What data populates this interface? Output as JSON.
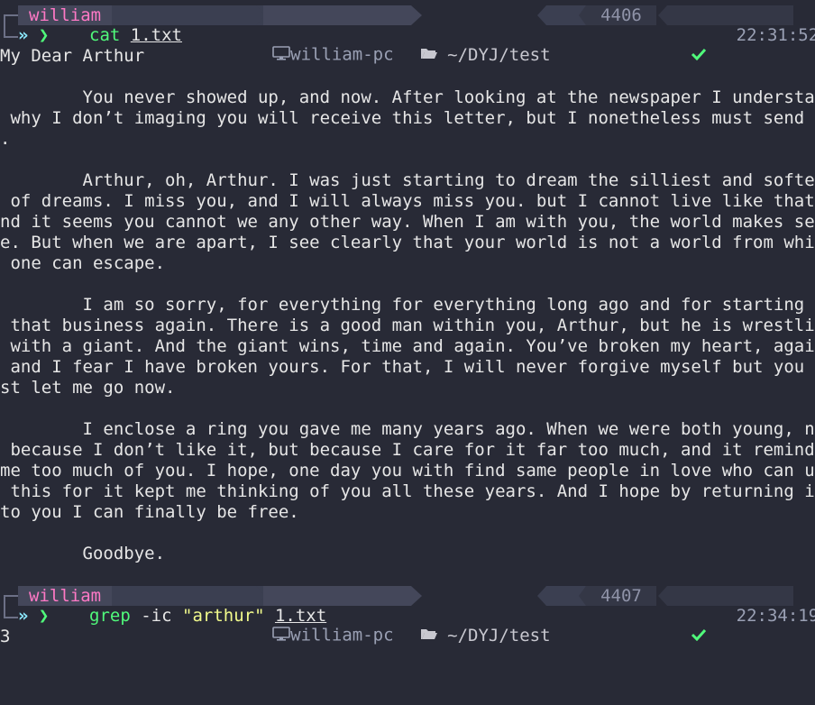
{
  "colors": {
    "background": "#282a36",
    "user": "#ff79c6",
    "command": "#50fa7b",
    "string": "#f1fa8c",
    "check": "#50fa7b"
  },
  "prompts": [
    {
      "user": "william",
      "host": "william-pc",
      "path": "~/DYJ/test",
      "status_icon": "check-icon",
      "history_number": "4406",
      "time": "22:31:52",
      "command": {
        "name": "cat",
        "args": [],
        "file": "1.txt"
      }
    },
    {
      "user": "william",
      "host": "william-pc",
      "path": "~/DYJ/test",
      "status_icon": "check-icon",
      "history_number": "4407",
      "time": "22:34:19",
      "command": {
        "name": "grep",
        "flag": "-ic",
        "pattern": "\"arthur\"",
        "file": "1.txt"
      }
    }
  ],
  "output_lines": [
    "My Dear Arthur",
    "",
    "        You never showed up, and now. After looking at the newspaper I understand",
    " why I don’t imaging you will receive this letter, but I nonetheless must send it",
    ".",
    "",
    "        Arthur, oh, Arthur. I was just starting to dream the silliest and softest",
    " of dreams. I miss you, and I will always miss you. but I cannot live like that a",
    "nd it seems you cannot we any other way. When I am with you, the world makes sens",
    "e. But when we are apart, I see clearly that your world is not a world from which",
    " one can escape.",
    "",
    "        I am so sorry, for everything for everything long ago and for starting up",
    " that business again. There is a good man within you, Arthur, but he is wrestling",
    " with a giant. And the giant wins, time and again. You’ve broken my heart, again,",
    " and I fear I have broken yours. For that, I will never forgive myself but you mu",
    "st let me go now.",
    "",
    "        I enclose a ring you gave me many years ago. When we were both young, not",
    " because I don’t like it, but because I care for it far too much, and it reminds",
    "me too much of you. I hope, one day you with find same people in love who can use",
    " this for it kept me thinking of you all these years. And I hope by returning it",
    "to you I can finally be free.",
    "",
    "        Goodbye."
  ],
  "grep_output": "3"
}
